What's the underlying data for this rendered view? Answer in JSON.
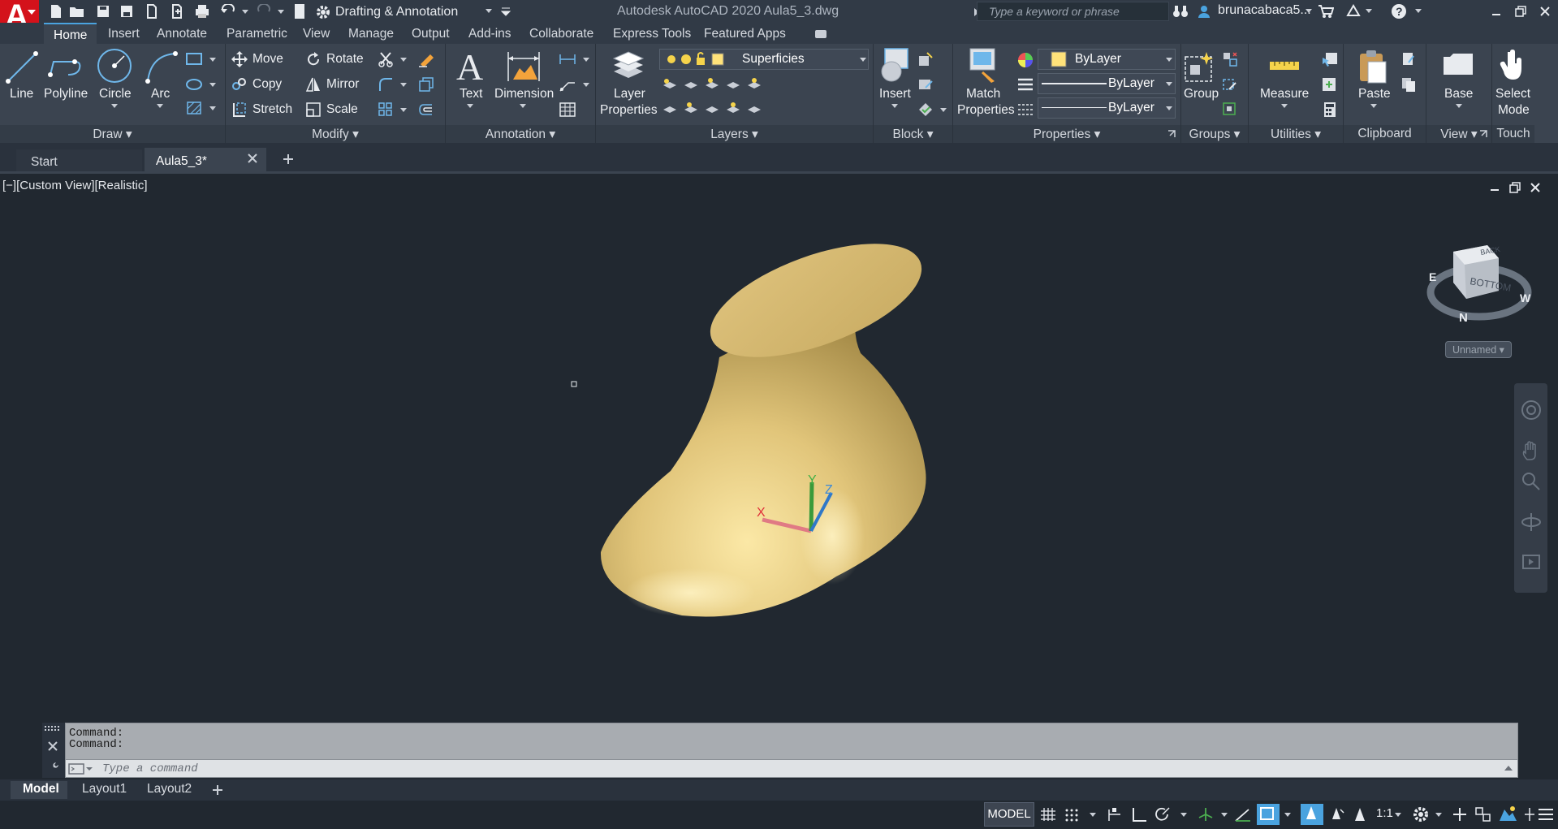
{
  "app": {
    "title": "Autodesk AutoCAD 2020    Aula5_3.dwg",
    "workspace": "Drafting & Annotation",
    "search_placeholder": "Type a keyword or phrase",
    "user": "brunacabaca5..."
  },
  "menu_tabs": [
    "Home",
    "Insert",
    "Annotate",
    "Parametric",
    "View",
    "Manage",
    "Output",
    "Add-ins",
    "Collaborate",
    "Express Tools",
    "Featured Apps"
  ],
  "ribbon": {
    "draw": {
      "title": "Draw",
      "line": "Line",
      "polyline": "Polyline",
      "circle": "Circle",
      "arc": "Arc"
    },
    "modify": {
      "title": "Modify",
      "move": "Move",
      "rotate": "Rotate",
      "copy": "Copy",
      "mirror": "Mirror",
      "stretch": "Stretch",
      "scale": "Scale"
    },
    "annotation": {
      "title": "Annotation",
      "text": "Text",
      "dimension": "Dimension"
    },
    "layers": {
      "title": "Layers",
      "layer_properties_1": "Layer",
      "layer_properties_2": "Properties",
      "current_layer": "Superficies"
    },
    "block": {
      "title": "Block",
      "insert": "Insert"
    },
    "properties": {
      "title": "Properties",
      "match_1": "Match",
      "match_2": "Properties",
      "color": "ByLayer",
      "linetype": "ByLayer",
      "lineweight": "ByLayer"
    },
    "groups": {
      "title": "Groups",
      "group": "Group"
    },
    "utilities": {
      "title": "Utilities",
      "measure": "Measure"
    },
    "clipboard": {
      "title": "Clipboard",
      "paste": "Paste"
    },
    "view": {
      "title": "View",
      "base": "Base"
    },
    "touch": {
      "title": "Touch",
      "select_1": "Select",
      "select_2": "Mode"
    }
  },
  "doc_tabs": {
    "start": "Start",
    "active": "Aula5_3*"
  },
  "viewport": {
    "label": "[−][Custom View][Realistic]",
    "viewcube_top": "BACK",
    "viewcube_face": "BOTTOM",
    "compass_n": "N",
    "compass_w": "W",
    "compass_e": "E",
    "named_view": "Unnamed"
  },
  "ucs": {
    "x": "X",
    "y": "Y",
    "z": "Z"
  },
  "command": {
    "history": [
      "Command:",
      "Command:"
    ],
    "placeholder": "Type a command"
  },
  "layout_tabs": [
    "Model",
    "Layout1",
    "Layout2"
  ],
  "status": {
    "model": "MODEL",
    "scale": "1:1"
  },
  "colors": {
    "accent": "#4aa3df",
    "surface": "#d9c07a",
    "background": "#212830",
    "brand": "#d4121b"
  }
}
